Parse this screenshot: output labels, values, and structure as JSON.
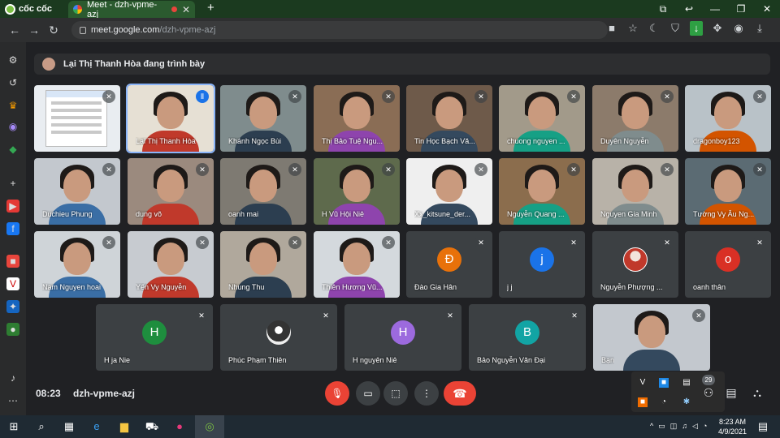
{
  "browser": {
    "brand": "cốc cốc",
    "tab_title": "Meet - dzh-vpme-azj",
    "url_host": "meet.google.com",
    "url_path": "/dzh-vpme-azj"
  },
  "presenter_banner": "Lại Thị Thanh Hòa đang trình bày",
  "participants": [
    {
      "name": "",
      "kind": "slides"
    },
    {
      "name": "Lại Thị Thanh Hòa",
      "kind": "video",
      "speaking": true
    },
    {
      "name": "Khánh Ngọc Bùi",
      "kind": "video"
    },
    {
      "name": "Thị Bảo Tuệ Ngu...",
      "kind": "video"
    },
    {
      "name": "Tin Học Bạch Vă...",
      "kind": "video"
    },
    {
      "name": "chuong nguyen ...",
      "kind": "video"
    },
    {
      "name": "Duyên Nguyễn",
      "kind": "video"
    },
    {
      "name": "dragonboy123",
      "kind": "video"
    },
    {
      "name": "Duchieu Phung",
      "kind": "video"
    },
    {
      "name": "dung võ",
      "kind": "video"
    },
    {
      "name": "oanh mai",
      "kind": "video"
    },
    {
      "name": "H Vũ Hội Niê",
      "kind": "video"
    },
    {
      "name": "Xx_kitsune_der...",
      "kind": "video"
    },
    {
      "name": "Nguyễn Quang ...",
      "kind": "video"
    },
    {
      "name": "Nguyen Gia Minh",
      "kind": "video"
    },
    {
      "name": "Tường Vy Âu Ng...",
      "kind": "video"
    },
    {
      "name": "Nam Nguyen hoai",
      "kind": "video"
    },
    {
      "name": "Yến Vy Nguyễn",
      "kind": "video"
    },
    {
      "name": "Nhung Thu",
      "kind": "video"
    },
    {
      "name": "Thiên Hương Vũ...",
      "kind": "video"
    },
    {
      "name": "Đào Gia Hân",
      "kind": "avatar",
      "initial": "Đ",
      "color": "#e8710a"
    },
    {
      "name": "j j",
      "kind": "avatar",
      "initial": "j",
      "color": "#1a73e8"
    },
    {
      "name": "Nguyễn Phượng ...",
      "kind": "photo"
    },
    {
      "name": "oanh thân",
      "kind": "avatar",
      "initial": "o",
      "color": "#d93025"
    },
    {
      "name": "H ja Nie",
      "kind": "avatar",
      "initial": "H",
      "color": "#1e8e3e"
    },
    {
      "name": "Phúc Phạm Thiên",
      "kind": "photo2"
    },
    {
      "name": "H nguyên Niê",
      "kind": "avatar",
      "initial": "H",
      "color": "#9c6ade"
    },
    {
      "name": "Bảo Nguyễn Văn Đại",
      "kind": "avatar",
      "initial": "B",
      "color": "#12a4a4"
    },
    {
      "name": "Bạn",
      "kind": "video"
    }
  ],
  "bottom": {
    "time": "08:23",
    "meeting_code": "dzh-vpme-azj",
    "participant_count": "29"
  },
  "taskbar": {
    "time": "8:23 AM",
    "date": "4/9/2021"
  }
}
